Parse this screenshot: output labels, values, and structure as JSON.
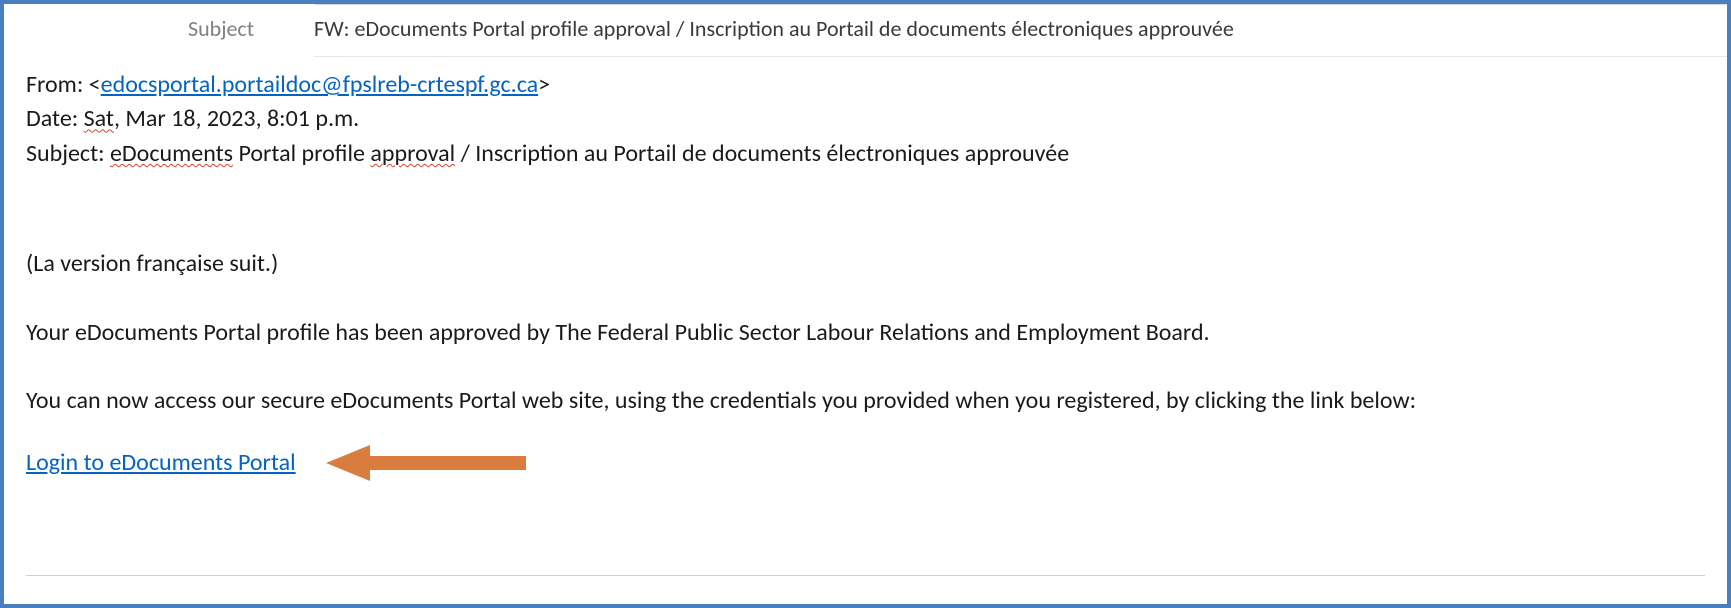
{
  "header": {
    "subject_label": "Subject",
    "subject_value": "FW: eDocuments Portal profile approval / Inscription au Portail de documents électroniques approuvée"
  },
  "meta": {
    "from_label": "From: <",
    "from_email": "edocsportal.portaildoc@fpslreb-crtespf.gc.ca",
    "from_close": ">",
    "date_label": "Date: ",
    "date_sat": "Sat",
    "date_rest": ", Mar 18, 2023, 8:01 p.m.",
    "subj_label": "Subject: ",
    "subj_w1": "eDocuments",
    "subj_mid1": " Portal profile ",
    "subj_w2": "approval",
    "subj_rest": " / Inscription au Portail de documents électroniques approuvée"
  },
  "body": {
    "fr_notice": "(La version française suit.)",
    "p1": "Your eDocuments Portal profile has been approved by The Federal Public Sector Labour Relations and Employment Board.",
    "p2": "You can now access our secure eDocuments Portal web site, using the credentials you provided when you registered, by clicking the link below:",
    "login_link": "Login to eDocuments Portal"
  },
  "colors": {
    "border": "#4a7fbf",
    "link": "#0563c1",
    "arrow": "#d97d3e"
  }
}
